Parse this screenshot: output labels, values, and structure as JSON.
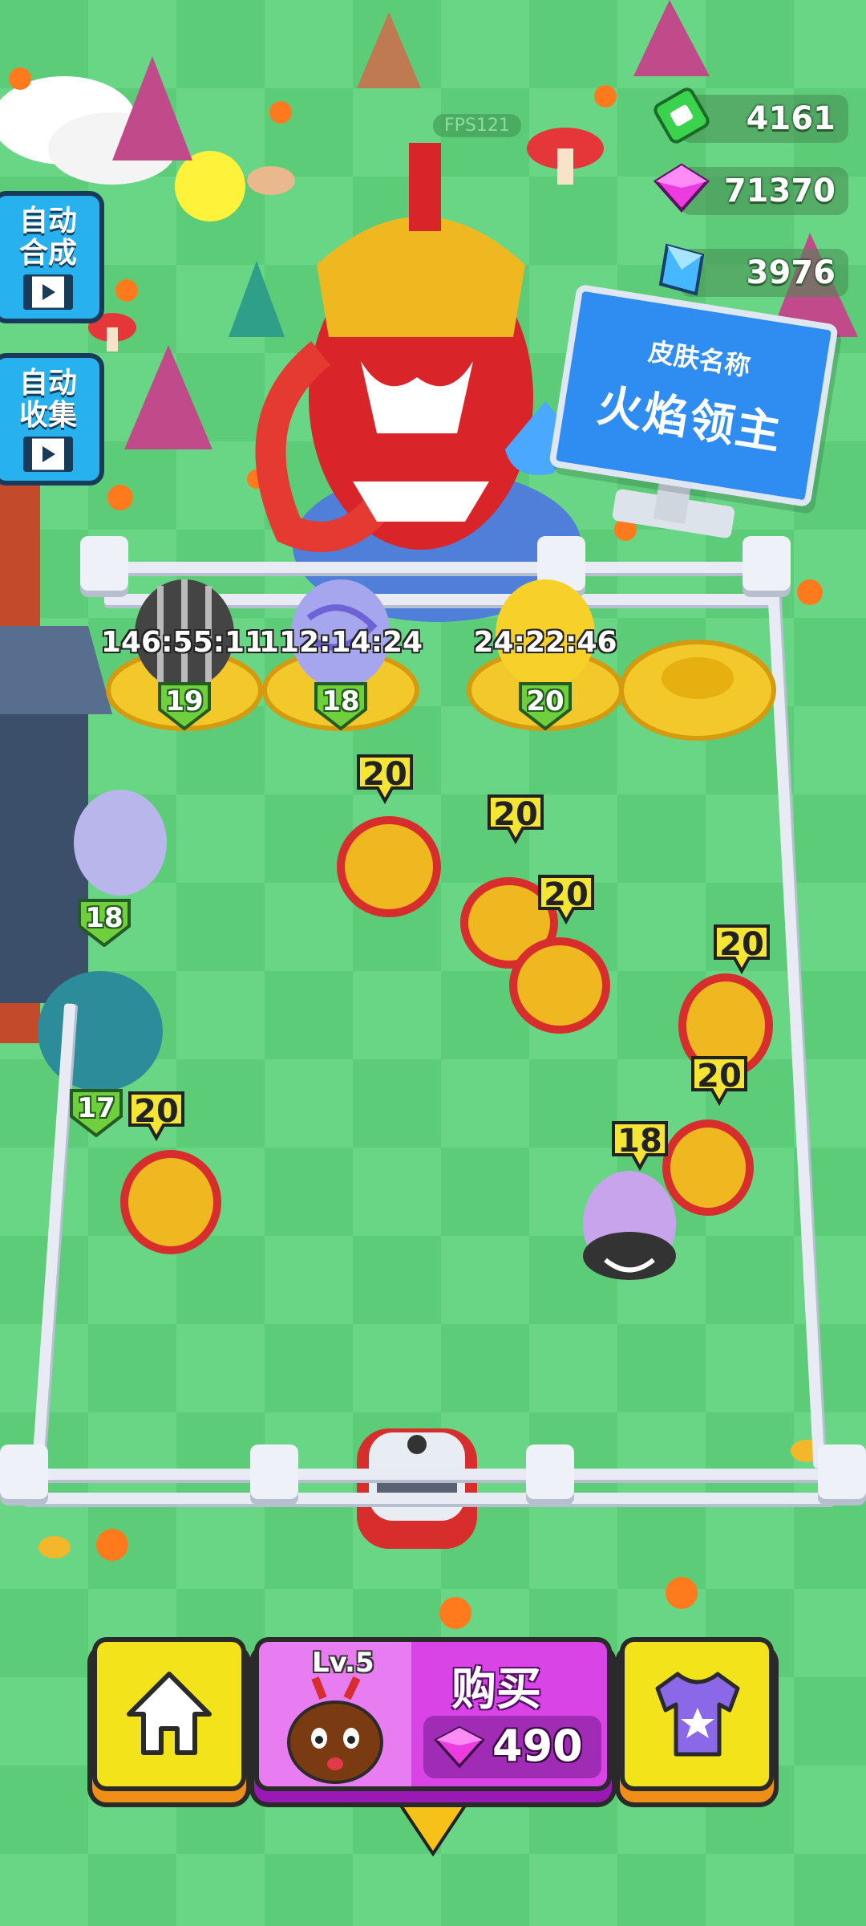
{
  "hud": {
    "fps": "FPS121",
    "cash": "4161",
    "gems_pink": "71370",
    "gems_blue": "3976",
    "icons": [
      "cash-icon",
      "pink-gem-icon",
      "blue-crystal-icon"
    ]
  },
  "left_buttons": {
    "auto_merge": [
      "自动",
      "合成"
    ],
    "auto_collect": [
      "自动",
      "收集"
    ]
  },
  "sign": {
    "line1": "皮肤名称",
    "line2": "火焰领主"
  },
  "nests": [
    {
      "timer": "146:55:11",
      "level": "19"
    },
    {
      "timer": "112:14:24",
      "level": "18"
    },
    {
      "timer": "24:22:46",
      "level": "20"
    },
    {
      "timer": "",
      "level": ""
    }
  ],
  "eggs_left": [
    {
      "level": "18"
    },
    {
      "level": "17"
    }
  ],
  "creatures": [
    {
      "level": "20"
    },
    {
      "level": "20"
    },
    {
      "level": "20"
    },
    {
      "level": "20"
    },
    {
      "level": "20"
    },
    {
      "level": "20"
    },
    {
      "level": "18"
    }
  ],
  "bottom_bar": {
    "home_icon": "home-icon",
    "buy_level": "Lv.5",
    "buy_label": "购买",
    "buy_price": "490",
    "shirt_icon": "shirt-star-icon"
  },
  "colors": {
    "grass_light": "#69d685",
    "grass_dark": "#5ccc79",
    "yellow_button": "#f3e31a",
    "purple_button": "#d944e6",
    "blue_button": "#27b2ef"
  }
}
